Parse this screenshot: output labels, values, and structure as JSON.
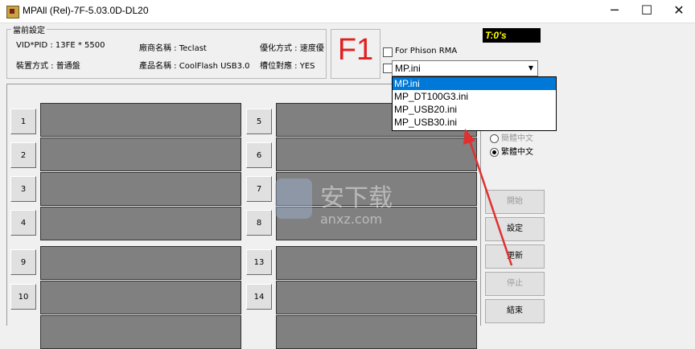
{
  "window": {
    "title": "MPAll (Rel)-7F-5.03.0D-DL20",
    "minimize_glyph": "─",
    "maximize_glyph": "☐",
    "close_glyph": "✕"
  },
  "settings": {
    "group_label": "當前設定",
    "vid_pid": "VID*PID : 13FE * 5500",
    "vendor": "廠商名稱 : Teclast",
    "optimize": "優化方式 : 速度優",
    "mode": "裝置方式 : 普通盤",
    "product": "產品名稱 : CoolFlash USB3.0",
    "symmetry": "槽位對應 : YES"
  },
  "f1_label": "F1",
  "phison_rma_label": "For Phison RMA",
  "timer": "T:0's",
  "ini_combo": {
    "value": "MP.ini",
    "options": [
      "MP.ini",
      "MP_DT100G3.ini",
      "MP_USB20.ini",
      "MP_USB30.ini"
    ],
    "selected_index": 0
  },
  "ports_left": [
    "1",
    "2",
    "3",
    "4",
    "9",
    "10"
  ],
  "ports_right": [
    "5",
    "6",
    "7",
    "8",
    "13",
    "14"
  ],
  "language": {
    "simplified": "簡體中文",
    "traditional": "繁體中文",
    "selected": "traditional"
  },
  "buttons": {
    "start": "開始",
    "settings": "設定",
    "refresh": "更新",
    "stop": "停止",
    "exit": "結束"
  },
  "watermark": {
    "text": "安下载",
    "sub": "anxz.com"
  },
  "colors": {
    "selection": "#0078d7",
    "f1": "#e02020",
    "timer_bg": "#000000",
    "timer_fg": "#ffff00",
    "arrow": "#e03030",
    "slot": "#808080"
  }
}
